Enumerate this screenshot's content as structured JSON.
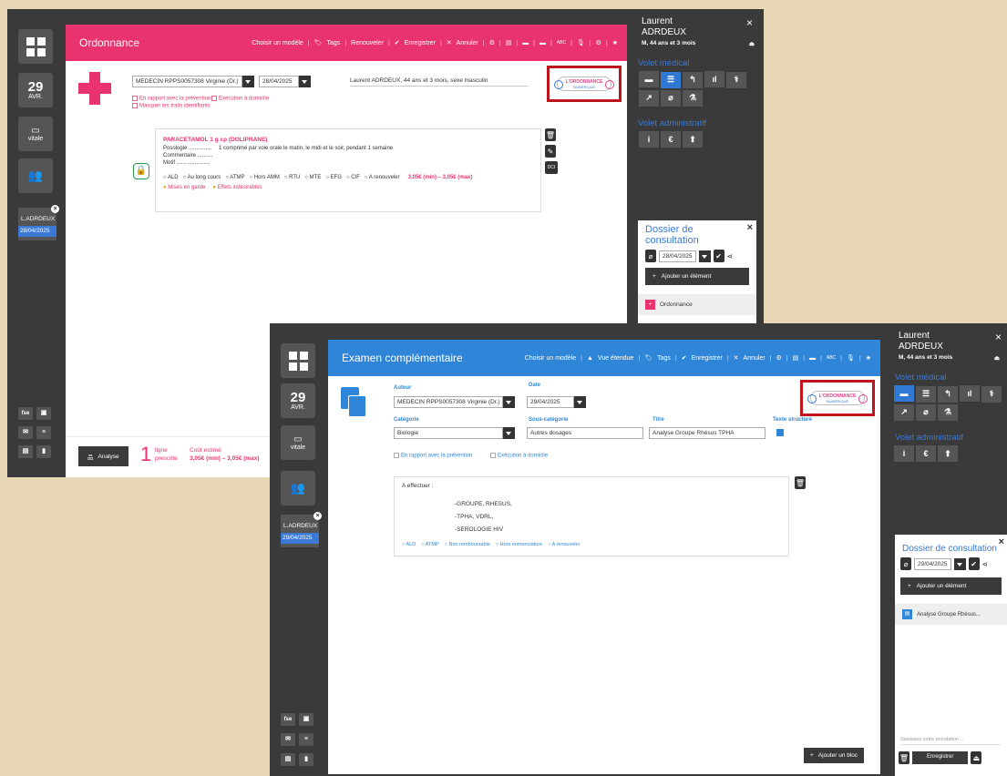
{
  "w1": {
    "day": "29",
    "month": "AVR.",
    "vitale": "vitale",
    "folder_name": "L.ADRDEUX",
    "folder_date": "28/04/2025",
    "fse": "fse",
    "title": "Ordonnance",
    "toolbar": [
      "Choisir un modèle",
      "Tags",
      "Renouveler",
      "Enregistrer",
      "Annuler",
      "ABC"
    ],
    "doctor": "MEDECIN RPPS0057308 Virginie (Dr.)",
    "date": "28/04/2025",
    "patient_line": "Laurent ADRDEUX, 44 ans et 3 mois, sexe masculin",
    "opt1": "En rapport avec la prévention",
    "opt2": "Exécution à domicile",
    "opt3": "Masquer les traits identifiants",
    "drug": "PARACETAMOL 1 g cp (DOLIPRANE)",
    "posologie_label": "Posologie ...............",
    "posologie": "1 comprimé par voie orale le matin, le midi et le soir, pendant 1 semaine",
    "commentaire": "Commentaire ..........",
    "motif": "Motif ......................",
    "radios": [
      "ALD",
      "Au long cours",
      "ATMP",
      "Hors AMM",
      "RTU",
      "MTE",
      "EFG",
      "CIF",
      "A renouveler"
    ],
    "cost": "3,05€ (min) – 3,05€ (max)",
    "warn1": "Mises en garde",
    "warn2": "Effets indésirables",
    "dci": "DCI",
    "analyse": "Analyse",
    "count": "1",
    "ligne": "ligne",
    "prescrite": "prescrite",
    "cout_label": "Coût estimé",
    "cout_value": "3,05€ (min) – 3,05€ (max)",
    "rp_first": "Laurent",
    "rp_last": "ADRDEUX",
    "rp_age": "M, 44 ans et 3 mois",
    "volet_med": "Volet médical",
    "volet_adm": "Volet administratif",
    "dossier_title": "Dossier de consultation",
    "dossier_date": "28/04/2025",
    "add_elem": "Ajouter un élément",
    "item": "Ordonnance"
  },
  "w2": {
    "day": "29",
    "month": "AVR.",
    "vitale": "vitale",
    "folder_name": "L.ADRDEUX",
    "folder_date": "29/04/2025",
    "fse": "fse",
    "title": "Examen complémentaire",
    "toolbar": [
      "Choisir un modèle",
      "Vue étendue",
      "Tags",
      "Enregistrer",
      "Annuler",
      "ABC"
    ],
    "auteur_label": "Auteur",
    "auteur": "MEDECIN RPPS0057308 Virginie (Dr.)",
    "date_label": "Date",
    "date": "29/04/2025",
    "cat_label": "Catégorie",
    "cat": "Biologie",
    "subcat_label": "Sous-catégorie",
    "subcat": "Autres dosages",
    "titre_label": "Titre",
    "titre": "Analyse Groupe Rhésus TPHA",
    "struct_label": "Texte structuré",
    "opt1": "En rapport avec la prévention",
    "opt2": "Exécution à domicile",
    "effectuer": "A effectuer :",
    "lines": [
      "-GROUPE, RHESUS,",
      "-TPHA, VDRL,",
      "-SEROLOGIE HIV"
    ],
    "radios": [
      "ALD",
      "ATMP",
      "Non remboursable",
      "Hors nomenclature",
      "A renouveler"
    ],
    "add_bloc": "Ajouter un bloc",
    "rp_first": "Laurent",
    "rp_last": "ADRDEUX",
    "rp_age": "M, 44 ans et 3 mois",
    "volet_med": "Volet médical",
    "volet_adm": "Volet administratif",
    "dossier_title": "Dossier de consultation",
    "dossier_date": "29/04/2025",
    "add_elem": "Ajouter un élément",
    "item": "Analyse Groupe Rhésus...",
    "annot_ph": "Saisissez votre annotation ...",
    "save": "Enregistrer"
  },
  "logo": {
    "l1": "L'ORDONNANCE",
    "l2": "NUMÉRIQUE"
  },
  "colors": {
    "pink": "#e8336f",
    "blue": "#2f86d8",
    "dark": "#3a3a3a"
  }
}
